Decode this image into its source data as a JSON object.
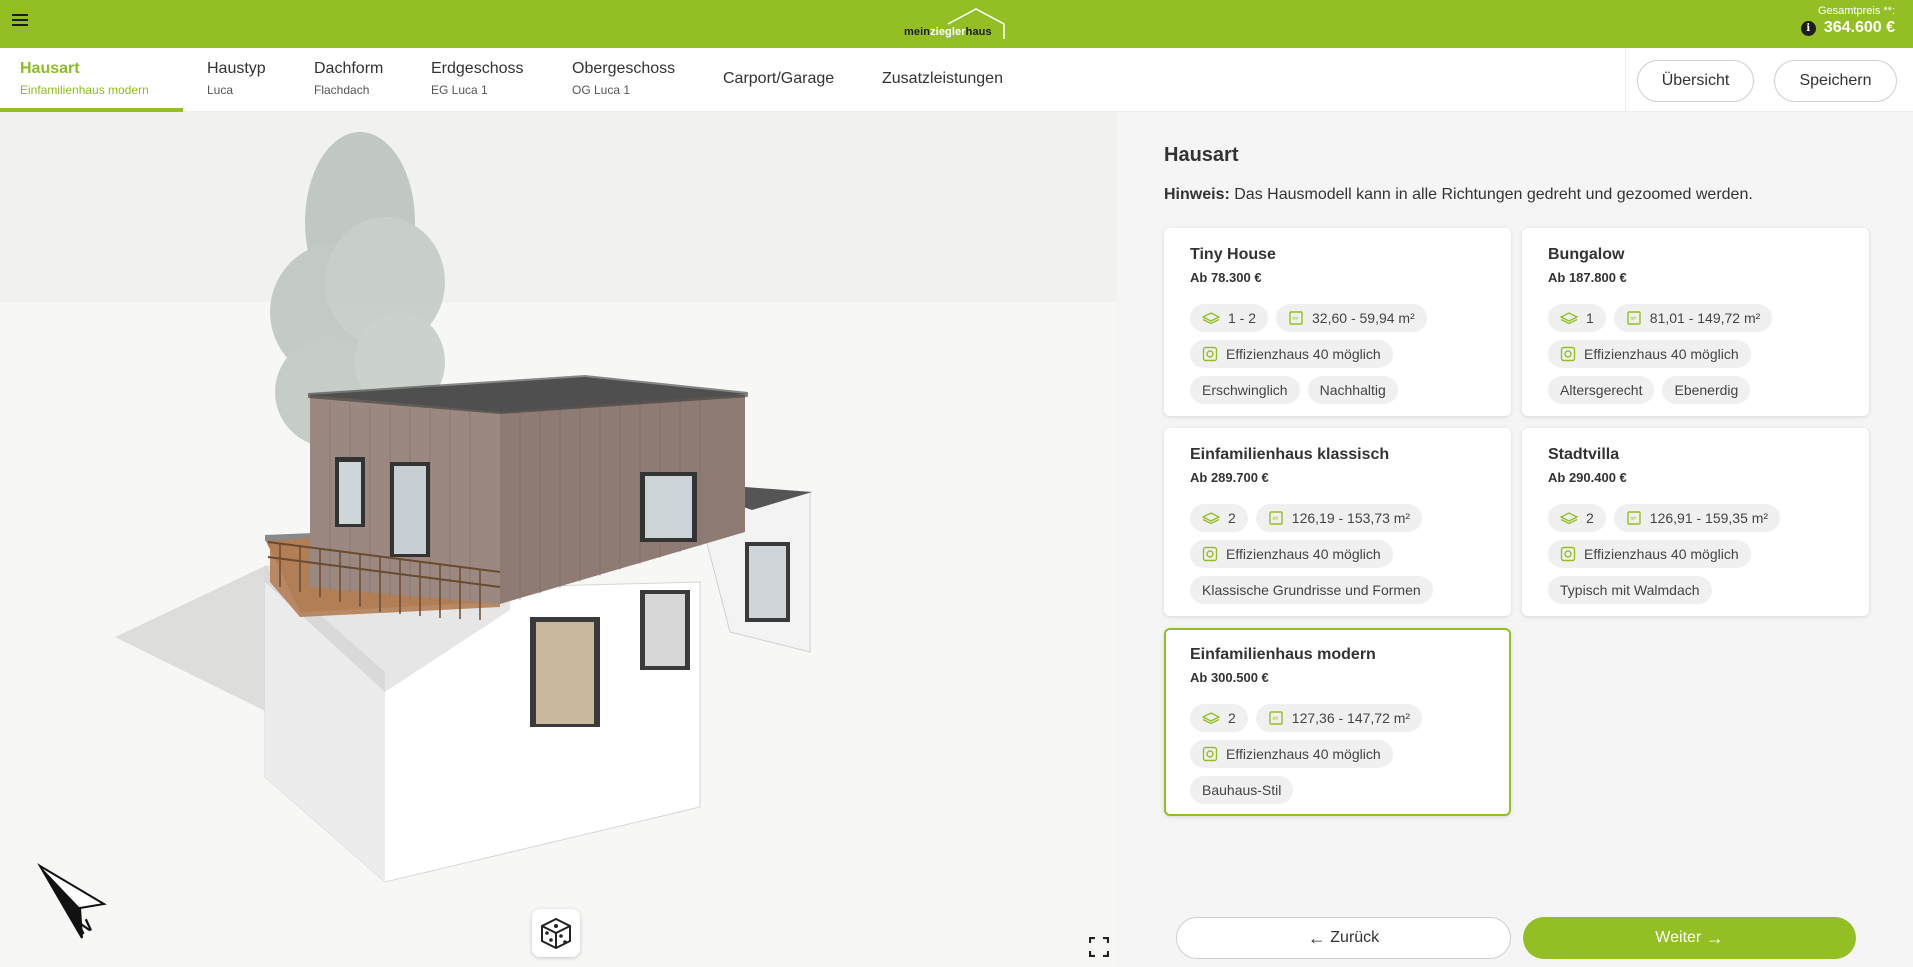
{
  "header": {
    "logo": {
      "part1": "mein",
      "part2": "ziegler",
      "part3": "haus"
    },
    "price_label": "Gesamtpreis **:",
    "price_value": "364.600 €",
    "info_icon": "i"
  },
  "nav": {
    "tabs": [
      {
        "title": "Hausart",
        "sub": "Einfamilienhaus modern",
        "active": true
      },
      {
        "title": "Haustyp",
        "sub": "Luca"
      },
      {
        "title": "Dachform",
        "sub": "Flachdach"
      },
      {
        "title": "Erdgeschoss",
        "sub": "EG Luca 1"
      },
      {
        "title": "Obergeschoss",
        "sub": "OG Luca 1"
      },
      {
        "title": "Carport/Garage"
      },
      {
        "title": "Zusatzleistungen"
      }
    ],
    "overview_label": "Übersicht",
    "save_label": "Speichern"
  },
  "viewport": {
    "icons": [
      "compass-icon",
      "dice-icon",
      "fullscreen-icon"
    ]
  },
  "panel": {
    "title": "Hausart",
    "hint_bold": "Hinweis:",
    "hint_text": " Das Hausmodell kann in alle Richtungen gedreht und gezoomed werden.",
    "cards": [
      {
        "title": "Tiny House",
        "price": "Ab 78.300 €",
        "floors": "1 - 2",
        "area": "32,60 - 59,94 m²",
        "efficiency": "Effizienzhaus 40 möglich",
        "tags": [
          "Erschwinglich",
          "Nachhaltig"
        ]
      },
      {
        "title": "Bungalow",
        "price": "Ab 187.800 €",
        "floors": "1",
        "area": "81,01 - 149,72 m²",
        "efficiency": "Effizienzhaus 40 möglich",
        "tags": [
          "Altersgerecht",
          "Ebenerdig"
        ]
      },
      {
        "title": "Einfamilienhaus klassisch",
        "price": "Ab 289.700 €",
        "floors": "2",
        "area": "126,19 - 153,73 m²",
        "efficiency": "Effizienzhaus 40 möglich",
        "tags": [
          "Klassische Grundrisse und Formen"
        ]
      },
      {
        "title": "Stadtvilla",
        "price": "Ab 290.400 €",
        "floors": "2",
        "area": "126,91 - 159,35 m²",
        "efficiency": "Effizienzhaus 40 möglich",
        "tags": [
          "Typisch mit Walmdach"
        ]
      },
      {
        "title": "Einfamilienhaus modern",
        "price": "Ab 300.500 €",
        "floors": "2",
        "area": "127,36 - 147,72 m²",
        "efficiency": "Effizienzhaus 40 möglich",
        "tags": [
          "Bauhaus-Stil"
        ],
        "selected": true
      }
    ],
    "back_label": "Zurück",
    "next_label": "Weiter"
  },
  "colors": {
    "accent": "#93bf24",
    "accent_text": "#8fbd22",
    "panel_bg": "#f5f5f5"
  }
}
